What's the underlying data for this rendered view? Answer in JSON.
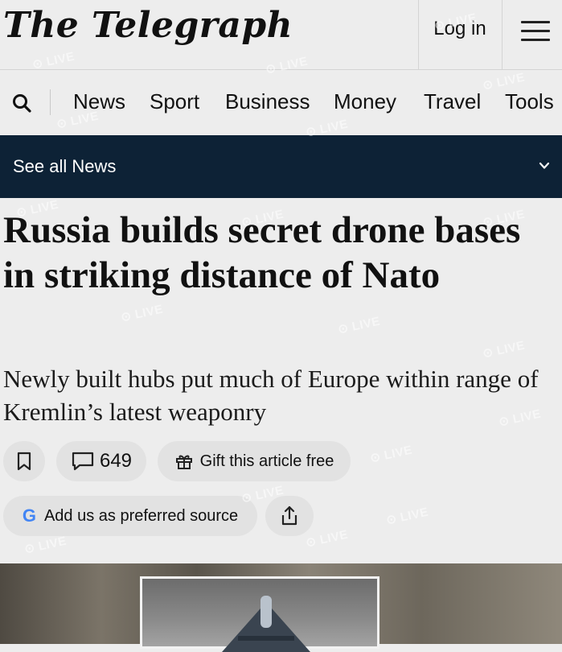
{
  "header": {
    "logo": "The Telegraph",
    "login_label": "Log in"
  },
  "nav": {
    "items": [
      "News",
      "Sport",
      "Business",
      "Money",
      "Travel",
      "Tools"
    ]
  },
  "section_bar": {
    "label": "See all News"
  },
  "article": {
    "headline": "Russia builds secret drone bases in striking distance of Nato",
    "standfirst": "Newly built hubs put much of Europe within range of Kremlin’s latest weaponry"
  },
  "actions": {
    "comments_count": "649",
    "gift_label": "Gift this article free",
    "preferred_source_label": "Add us as preferred source",
    "google_letter": "G"
  },
  "watermark": {
    "text": "⊙ LIVE"
  },
  "colors": {
    "section_bar_bg": "#0d2236",
    "page_bg": "#ededed",
    "button_bg": "#e2e2e2"
  }
}
